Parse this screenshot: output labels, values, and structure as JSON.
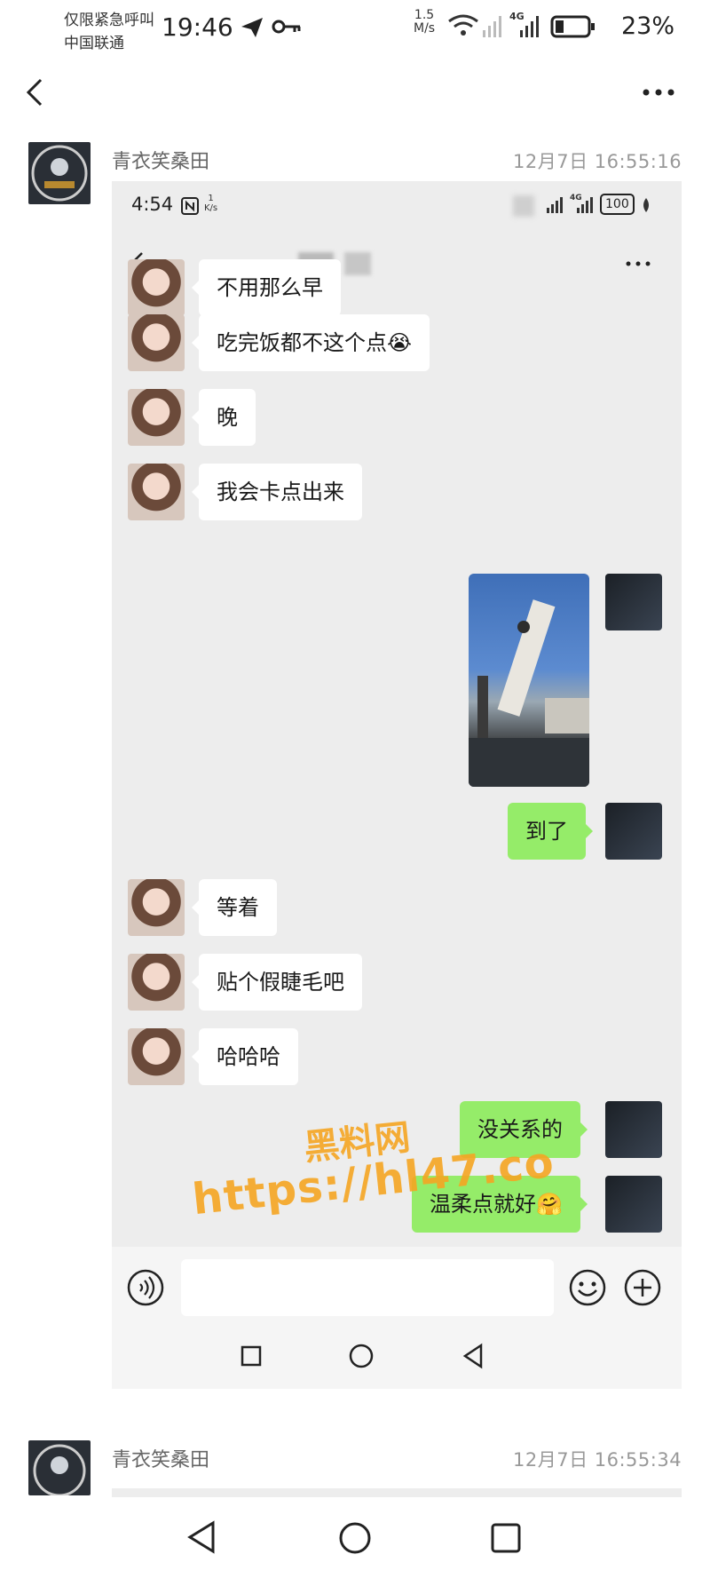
{
  "status_bar": {
    "carrier_line1": "仅限紧急呼叫",
    "carrier_line2": "中国联通",
    "time": "19:46",
    "net_speed_value": "1.5",
    "net_speed_unit": "M/s",
    "network": "4G",
    "battery": "23%"
  },
  "posts": [
    {
      "author": "青衣笑桑田",
      "time": "12月7日 16:55:16"
    },
    {
      "author": "青衣笑桑田",
      "time": "12月7日 16:55:34"
    }
  ],
  "screenshot": {
    "status": {
      "time": "4:54",
      "net_speed_value": "1",
      "net_speed_unit": "K/s",
      "network": "4G",
      "battery": "100"
    },
    "messages": [
      {
        "side": "left",
        "text": "不用那么早"
      },
      {
        "side": "left",
        "text": "吃完饭都不这个点😭"
      },
      {
        "side": "left",
        "text": "晚"
      },
      {
        "side": "left",
        "text": "我会卡点出来"
      },
      {
        "side": "right",
        "type": "image",
        "text": ""
      },
      {
        "side": "right",
        "text": "到了"
      },
      {
        "side": "left",
        "text": "等着"
      },
      {
        "side": "left",
        "text": "贴个假睫毛吧"
      },
      {
        "side": "left",
        "text": "哈哈哈"
      },
      {
        "side": "right",
        "text": "没关系的"
      },
      {
        "side": "right",
        "text": "温柔点就好🤗"
      }
    ]
  },
  "watermark": {
    "line1": "黑料网",
    "line2": "https://hl47.co"
  },
  "icons": {
    "outer_back": "chevron-left-icon",
    "outer_more": "more-dots-icon",
    "voice": "voice-icon",
    "emoji": "emoji-icon",
    "plus": "plus-icon"
  },
  "colors": {
    "chat_bg": "#ededed",
    "bubble_self": "#95ec69",
    "bubble_other": "#ffffff",
    "watermark": "#f5a623"
  }
}
